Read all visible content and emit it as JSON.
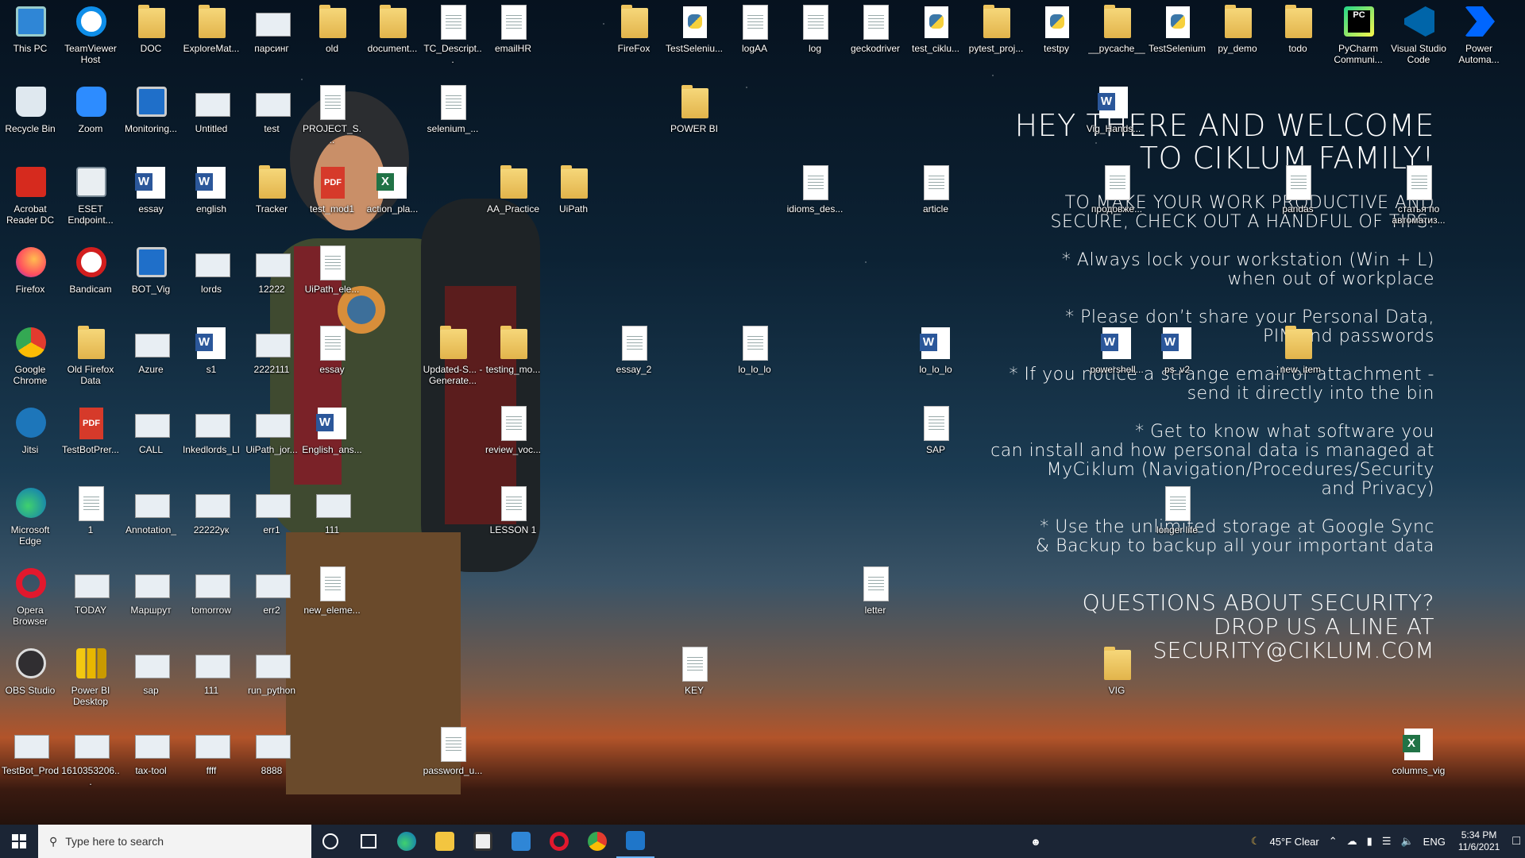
{
  "desktop": {
    "welcome": {
      "title_line1": "HEY THERE AND WELCOME",
      "title_line2": "TO CIKLUM FAMILY!",
      "intro": "TO MAKE YOUR WORK PRODUCTIVE AND\nSECURE, CHECK OUT A HANDFUL OF TIPS:",
      "tip1": "* Always lock your workstation (Win + L)\nwhen out of workplace",
      "tip2": "* Please don’t share your Personal Data,\nPIN and passwords",
      "tip3": "* If you notice a strange email or attachment -\nsend it directly into the bin",
      "tip4": "* Get to know what software you\ncan install and how personal data is managed at\nMyCiklum (Navigation/Procedures/Security\nand Privacy)",
      "tip5": "* Use the unlimited storage at Google Sync\n& Backup to backup all your important data",
      "questions": "QUESTIONS ABOUT SECURITY?\nDROP US A LINE AT\nSECURITY@CIKLUM.COM"
    },
    "icons": [
      {
        "label": "This PC",
        "type": "thispc"
      },
      {
        "label": "TeamViewer Host",
        "type": "teamviewer"
      },
      {
        "label": "DOC",
        "type": "folder"
      },
      {
        "label": "ExploreMat...",
        "type": "folder"
      },
      {
        "label": "парсинг",
        "type": "thumb"
      },
      {
        "label": "old",
        "type": "folder"
      },
      {
        "label": "document...",
        "type": "folder"
      },
      {
        "label": "TC_Descript...",
        "type": "doc"
      },
      {
        "label": "emailHR",
        "type": "doc"
      },
      {
        "label": "FireFox",
        "type": "folder"
      },
      {
        "label": "TestSeleniu...",
        "type": "py"
      },
      {
        "label": "logAA",
        "type": "doc"
      },
      {
        "label": "log",
        "type": "doc"
      },
      {
        "label": "geckodriver",
        "type": "doc"
      },
      {
        "label": "test_ciklu...",
        "type": "py"
      },
      {
        "label": "pytest_proj...",
        "type": "folder"
      },
      {
        "label": "testpy",
        "type": "py"
      },
      {
        "label": "__pycache__",
        "type": "folder"
      },
      {
        "label": "TestSelenium",
        "type": "py"
      },
      {
        "label": "py_demo",
        "type": "folder"
      },
      {
        "label": "todo",
        "type": "folder"
      },
      {
        "label": "PyCharm Communi...",
        "type": "pycharm"
      },
      {
        "label": "Visual Studio Code",
        "type": "vscode"
      },
      {
        "label": "Power Automa...",
        "type": "powerautomate"
      },
      {
        "label": "Recycle Bin",
        "type": "recycle"
      },
      {
        "label": "Zoom",
        "type": "zoom"
      },
      {
        "label": "Monitoring...",
        "type": "monitor"
      },
      {
        "label": "Untitled",
        "type": "thumb"
      },
      {
        "label": "test",
        "type": "thumb"
      },
      {
        "label": "PROJECT_S...",
        "type": "doc"
      },
      {
        "label": "selenium_...",
        "type": "doc"
      },
      {
        "label": "POWER BI",
        "type": "folder"
      },
      {
        "label": "Vig_Hands...",
        "type": "word"
      },
      {
        "label": "Acrobat Reader DC",
        "type": "acrobat"
      },
      {
        "label": "ESET Endpoint...",
        "type": "eset"
      },
      {
        "label": "essay",
        "type": "word"
      },
      {
        "label": "english",
        "type": "word"
      },
      {
        "label": "Tracker",
        "type": "folder"
      },
      {
        "label": "test_mod1",
        "type": "pdf"
      },
      {
        "label": "action_pla...",
        "type": "excel"
      },
      {
        "label": "AA_Practice",
        "type": "folder"
      },
      {
        "label": "UiPath",
        "type": "folder"
      },
      {
        "label": "idioms_des...",
        "type": "doc"
      },
      {
        "label": "article",
        "type": "doc"
      },
      {
        "label": "продовже...",
        "type": "doc"
      },
      {
        "label": "pandas",
        "type": "doc"
      },
      {
        "label": "статья по автоматиз...",
        "type": "doc"
      },
      {
        "label": "Firefox",
        "type": "firefox"
      },
      {
        "label": "Bandicam",
        "type": "bandicam"
      },
      {
        "label": "BOT_Vig",
        "type": "monitor"
      },
      {
        "label": "lords",
        "type": "thumb"
      },
      {
        "label": "12222",
        "type": "thumb"
      },
      {
        "label": "UiPath_ele...",
        "type": "doc"
      },
      {
        "label": "Google Chrome",
        "type": "chrome"
      },
      {
        "label": "Old Firefox Data",
        "type": "folder"
      },
      {
        "label": "Azure",
        "type": "thumb"
      },
      {
        "label": "s1",
        "type": "word"
      },
      {
        "label": "2222111",
        "type": "thumb"
      },
      {
        "label": "essay",
        "type": "doc"
      },
      {
        "label": "Updated-S... - Generate...",
        "type": "folder"
      },
      {
        "label": "testing_mo...",
        "type": "folder"
      },
      {
        "label": "essay_2",
        "type": "doc"
      },
      {
        "label": "lo_lo_lo",
        "type": "doc"
      },
      {
        "label": "lo_lo_lo",
        "type": "word"
      },
      {
        "label": "powershell...",
        "type": "word"
      },
      {
        "label": "ps_v2",
        "type": "word"
      },
      {
        "label": "_new_item",
        "type": "folder"
      },
      {
        "label": "Jitsi",
        "type": "jitsi"
      },
      {
        "label": "TestBotPrer...",
        "type": "pdf"
      },
      {
        "label": "CALL",
        "type": "thumb"
      },
      {
        "label": "Inkedlords_LI",
        "type": "thumb"
      },
      {
        "label": "UiPath_jor...",
        "type": "thumb"
      },
      {
        "label": "English_ans...",
        "type": "word"
      },
      {
        "label": "review_voc...",
        "type": "doc"
      },
      {
        "label": "SAP",
        "type": "doc"
      },
      {
        "label": "Microsoft Edge",
        "type": "edge"
      },
      {
        "label": "1",
        "type": "doc"
      },
      {
        "label": "Annotation_",
        "type": "thumb"
      },
      {
        "label": "22222ук",
        "type": "thumb"
      },
      {
        "label": "err1",
        "type": "thumb"
      },
      {
        "label": "111",
        "type": "thumb"
      },
      {
        "label": "LESSON 1",
        "type": "doc"
      },
      {
        "label": "longer life",
        "type": "doc"
      },
      {
        "label": "Opera Browser",
        "type": "opera"
      },
      {
        "label": "TODAY",
        "type": "thumb"
      },
      {
        "label": "Маршрут",
        "type": "thumb"
      },
      {
        "label": "tomorrow",
        "type": "thumb"
      },
      {
        "label": "err2",
        "type": "thumb"
      },
      {
        "label": "new_eleme...",
        "type": "doc"
      },
      {
        "label": "letter",
        "type": "doc"
      },
      {
        "label": "OBS Studio",
        "type": "obs"
      },
      {
        "label": "Power BI Desktop",
        "type": "powerbi"
      },
      {
        "label": "sap",
        "type": "thumb"
      },
      {
        "label": "111",
        "type": "thumb"
      },
      {
        "label": "run_python",
        "type": "thumb"
      },
      {
        "label": "KEY",
        "type": "doc"
      },
      {
        "label": "VIG",
        "type": "folder"
      },
      {
        "label": "TestBot_Prod",
        "type": "thumb"
      },
      {
        "label": "1610353206...",
        "type": "thumb"
      },
      {
        "label": "tax-tool",
        "type": "thumb"
      },
      {
        "label": "ffff",
        "type": "thumb"
      },
      {
        "label": "8888",
        "type": "thumb"
      },
      {
        "label": "password_u...",
        "type": "doc"
      },
      {
        "label": "columns_vig",
        "type": "excel"
      }
    ]
  },
  "taskbar": {
    "search_placeholder": "Type here to search",
    "apps": [
      "cortana-icon",
      "task-view-icon",
      "edge-icon",
      "file-explorer-icon",
      "store-icon",
      "mail-icon",
      "opera-icon",
      "chrome-icon",
      "app-icon"
    ],
    "weather": "45°F  Clear",
    "lang": "ENG",
    "time": "5:34 PM",
    "date": "11/6/2021"
  }
}
